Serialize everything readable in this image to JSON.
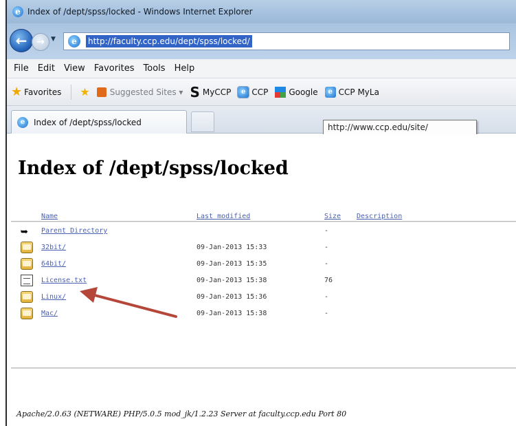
{
  "window": {
    "title": "Index of /dept/spss/locked - Windows Internet Explorer"
  },
  "address": {
    "url": "http://faculty.ccp.edu/dept/spss/locked/"
  },
  "menu": {
    "items": [
      "File",
      "Edit",
      "View",
      "Favorites",
      "Tools",
      "Help"
    ]
  },
  "favorites_bar": {
    "favorites_label": "Favorites",
    "items": [
      {
        "label": "Suggested Sites ▾",
        "icon": "suggested-sites-icon"
      },
      {
        "label": "MyCCP",
        "icon": "s-icon"
      },
      {
        "label": "CCP",
        "icon": "ie-page-icon"
      },
      {
        "label": "Google",
        "icon": "google-icon"
      },
      {
        "label": "CCP MyLa",
        "icon": "ie-page-icon"
      }
    ]
  },
  "tabs": {
    "active_label": "Index of /dept/spss/locked",
    "tooltip": "http://www.ccp.edu/site/"
  },
  "page": {
    "heading": "Index of /dept/spss/locked",
    "columns": {
      "name": "Name",
      "last_modified": "Last modified",
      "size": "Size",
      "description": "Description"
    },
    "rows": [
      {
        "name": "Parent Directory",
        "date": "",
        "size": "-",
        "icon": "back-icon"
      },
      {
        "name": "32bit/",
        "date": "09-Jan-2013 15:33",
        "size": "-",
        "icon": "folder-icon"
      },
      {
        "name": "64bit/",
        "date": "09-Jan-2013 15:35",
        "size": "-",
        "icon": "folder-icon"
      },
      {
        "name": "License.txt",
        "date": "09-Jan-2013 15:38",
        "size": "76",
        "icon": "text-file-icon"
      },
      {
        "name": "Linux/",
        "date": "09-Jan-2013 15:36",
        "size": "-",
        "icon": "folder-icon"
      },
      {
        "name": "Mac/",
        "date": "09-Jan-2013 15:38",
        "size": "-",
        "icon": "folder-icon"
      }
    ],
    "footer": "Apache/2.0.63 (NETWARE) PHP/5.0.5 mod_jk/1.2.23 Server at faculty.ccp.edu Port 80"
  },
  "colors": {
    "link": "#4a60b0",
    "annotation_arrow": "#b5473a",
    "url_highlight": "#3263c6"
  }
}
